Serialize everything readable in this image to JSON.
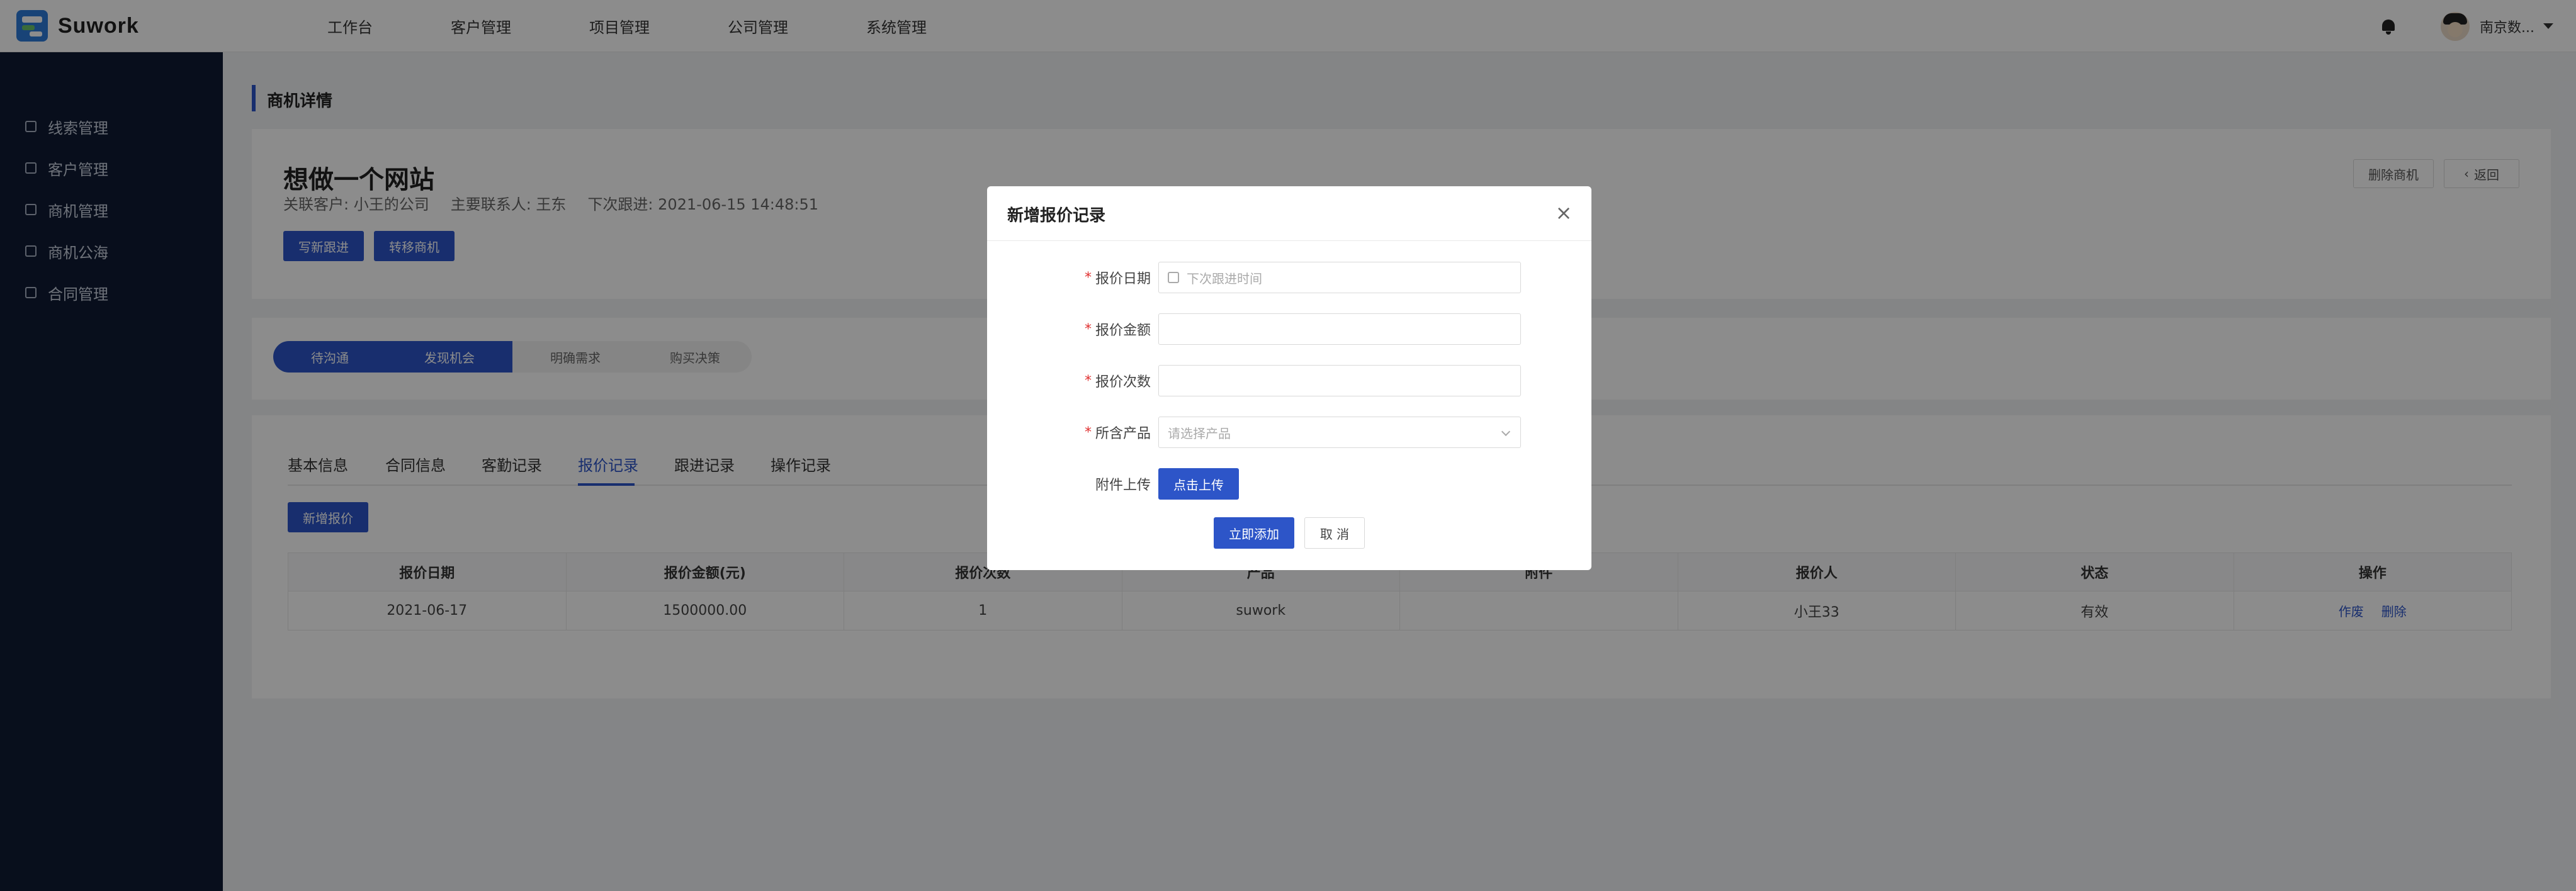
{
  "brand": {
    "name": "Suwork"
  },
  "topnav": [
    "工作台",
    "客户管理",
    "项目管理",
    "公司管理",
    "系统管理"
  ],
  "user": {
    "name": "南京数..."
  },
  "sidebar": {
    "items": [
      "线索管理",
      "客户管理",
      "商机管理",
      "商机公海",
      "合同管理"
    ]
  },
  "breadcrumb": {
    "title": "商机详情"
  },
  "deal": {
    "title": "想做一个网站",
    "customer": "关联客户: 小王的公司",
    "contact": "主要联系人: 王东",
    "next_follow": "下次跟进: 2021-06-15 14:48:51",
    "btn_write": "写新跟进",
    "btn_transfer": "转移商机",
    "btn_delete": "删除商机",
    "btn_back": "返回"
  },
  "stages": [
    "待沟通",
    "发现机会",
    "明确需求",
    "购买决策"
  ],
  "tabs": [
    "基本信息",
    "合同信息",
    "客勤记录",
    "报价记录",
    "跟进记录",
    "操作记录"
  ],
  "add_quote_btn": "新增报价",
  "table": {
    "headers": [
      "报价日期",
      "报价金额(元)",
      "报价次数",
      "产品",
      "附件",
      "报价人",
      "状态",
      "操作"
    ],
    "rows": [
      {
        "date": "2021-06-17",
        "amount": "1500000.00",
        "count": "1",
        "product": "suwork",
        "attachment": "",
        "person": "小王33",
        "status": "有效",
        "act_void": "作废",
        "act_delete": "删除"
      }
    ]
  },
  "modal": {
    "title": "新增报价记录",
    "close": "×",
    "date_label": "报价日期",
    "date_placeholder": "下次跟进时间",
    "amount_label": "报价金额",
    "count_label": "报价次数",
    "product_label": "所含产品",
    "product_placeholder": "请选择产品",
    "upload_label": "附件上传",
    "upload_btn": "点击上传",
    "submit": "立即添加",
    "cancel": "取 消"
  }
}
